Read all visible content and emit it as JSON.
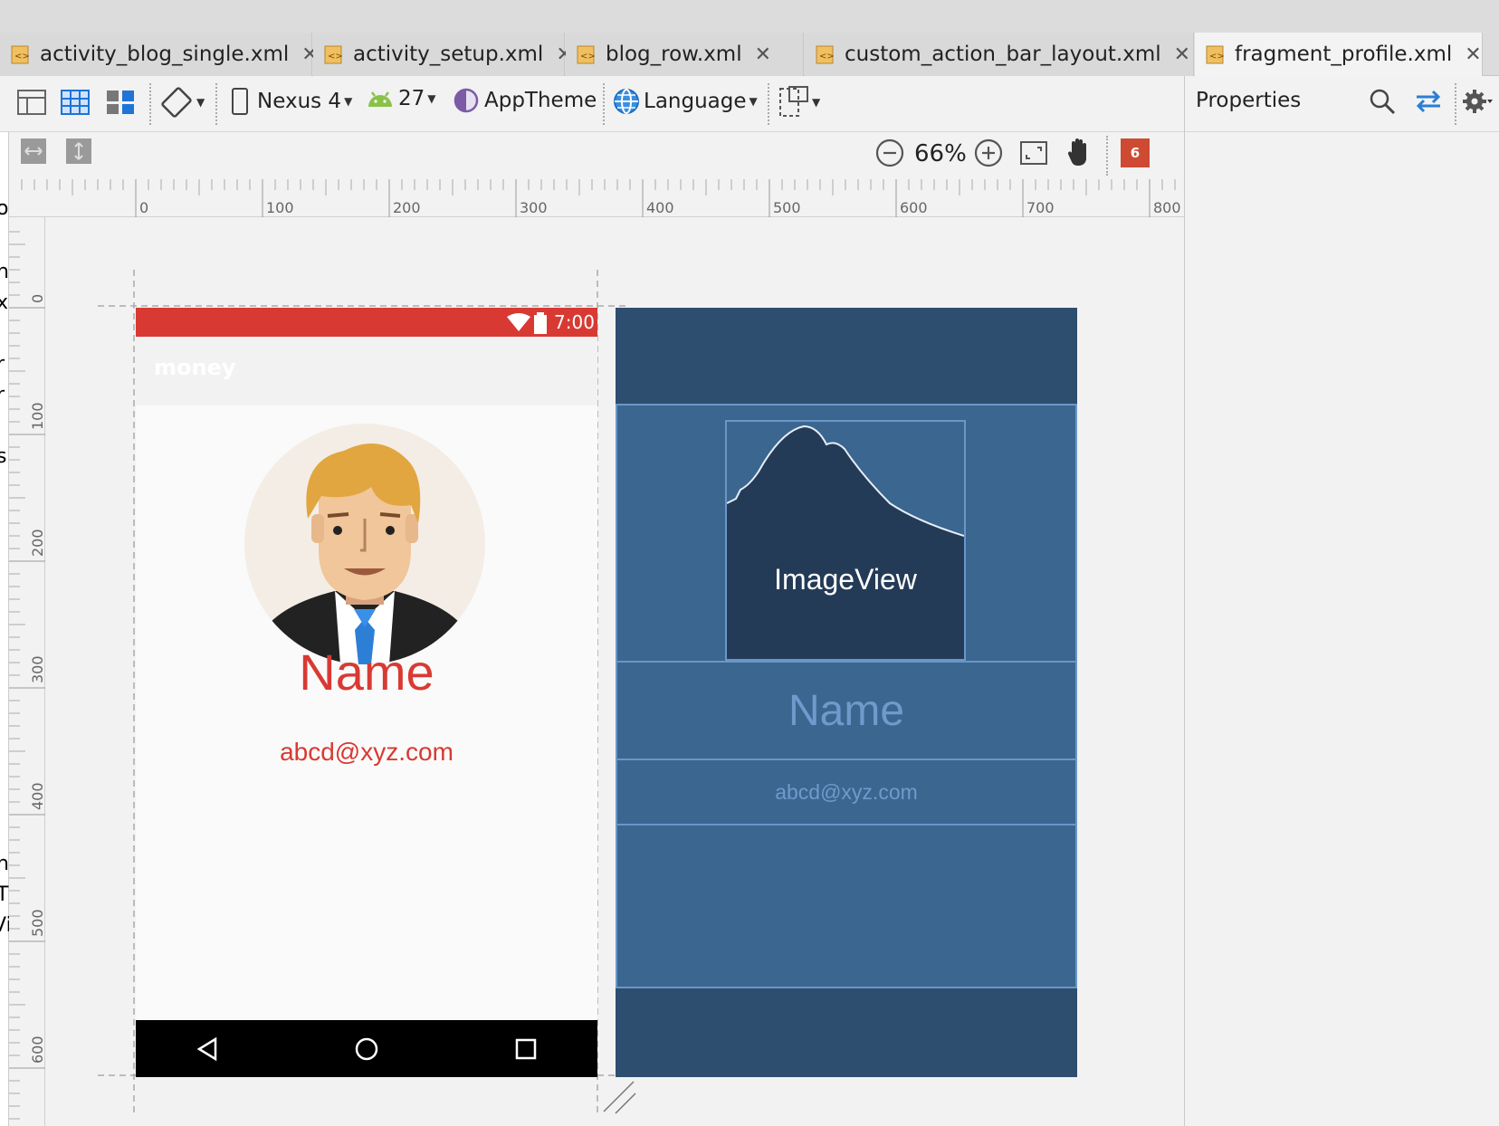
{
  "tabs": [
    {
      "label": "activity_blog_single.xml",
      "active": false
    },
    {
      "label": "activity_setup.xml",
      "active": false
    },
    {
      "label": "blog_row.xml",
      "active": false
    },
    {
      "label": "custom_action_bar_layout.xml",
      "active": false
    },
    {
      "label": "fragment_profile.xml",
      "active": true
    }
  ],
  "toolbar": {
    "device": "Nexus 4",
    "api": "27",
    "theme": "AppTheme",
    "language": "Language",
    "zoom": "66%",
    "issues_count": "6"
  },
  "properties": {
    "title": "Properties"
  },
  "ruler": {
    "h_ticks": [
      "0",
      "100",
      "200",
      "300",
      "400",
      "500",
      "600",
      "700",
      "800"
    ],
    "v_ticks": [
      "0",
      "100",
      "200",
      "300",
      "400",
      "500",
      "600"
    ]
  },
  "phone": {
    "status_time": "7:00",
    "appbar_title": "money",
    "name": "Name",
    "email": "abcd@xyz.com"
  },
  "blueprint": {
    "imageview_label": "ImageView",
    "name": "Name",
    "email": "abcd@xyz.com"
  },
  "left_edge_letters": [
    "o",
    "n",
    "x",
    "r",
    "r",
    "s",
    "n",
    "T",
    "Vi"
  ],
  "colors": {
    "accent_red": "#d83a33",
    "blueprint_bg": "#2d4e6f",
    "blueprint_box": "#3a6690",
    "blueprint_border": "#6b97c7"
  }
}
